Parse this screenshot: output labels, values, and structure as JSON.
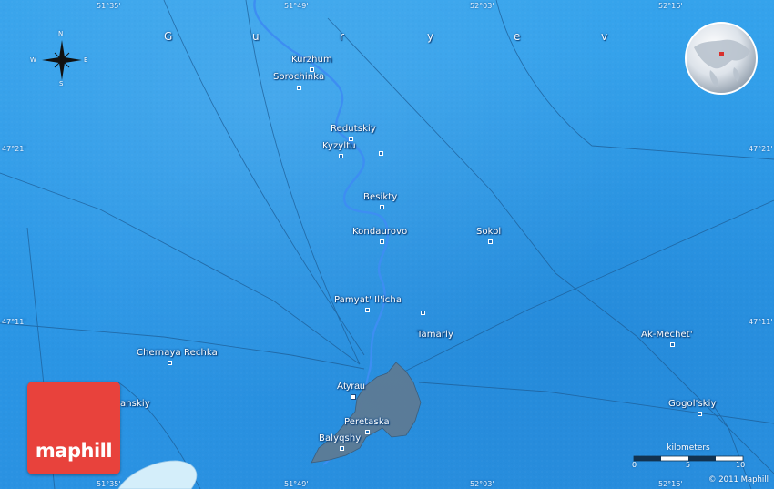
{
  "region_label": [
    "G",
    "u",
    "r",
    "y",
    "e",
    "v"
  ],
  "coordinates": {
    "top": [
      "51°35'",
      "51°49'",
      "52°03'",
      "52°16'"
    ],
    "bottom": [
      "51°35'",
      "51°49'",
      "52°03'",
      "52°16'"
    ],
    "left": [
      "47°21'",
      "47°11'"
    ],
    "right": [
      "47°21'",
      "47°11'"
    ]
  },
  "places": [
    {
      "name": "Kurzhum"
    },
    {
      "name": "Sorochinka"
    },
    {
      "name": "Redutskiy"
    },
    {
      "name": "Kyzyltu"
    },
    {
      "name": "Besikty"
    },
    {
      "name": "Kondaurovo"
    },
    {
      "name": "Sokol"
    },
    {
      "name": "Pamyat' Il'icha"
    },
    {
      "name": "Tamarly"
    },
    {
      "name": "Ak-Mechet'"
    },
    {
      "name": "Chernaya Rechka"
    },
    {
      "name": "Atyrau"
    },
    {
      "name": "anskiy"
    },
    {
      "name": "Gogol'skiy"
    },
    {
      "name": "Peretaska"
    },
    {
      "name": "Balyqshy"
    }
  ],
  "compass": {
    "n": "N",
    "s": "S",
    "e": "E",
    "w": "W"
  },
  "scale": {
    "title": "kilometers",
    "ticks": [
      "0",
      "5",
      "10"
    ]
  },
  "branding": {
    "logo_text": "maphill",
    "copyright": "© 2011 Maphill"
  },
  "colors": {
    "water": "#2a9ae8",
    "river": "#3f8ff0",
    "city": "#5d7b95",
    "logo": "#e8423c"
  }
}
